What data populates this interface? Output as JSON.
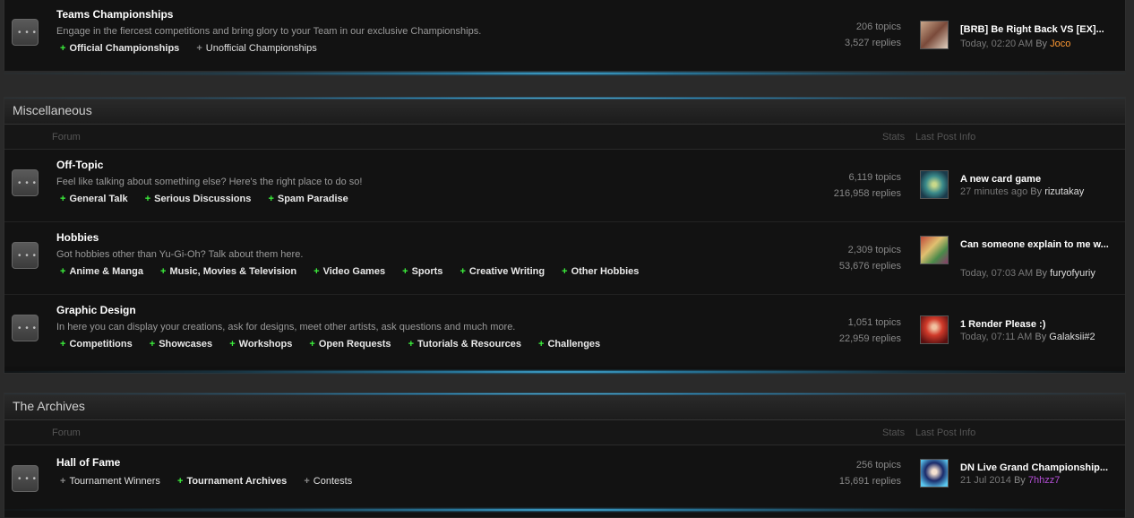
{
  "colors": {
    "accent_glow": "#5fd3ff",
    "plus_green": "#3cf13c",
    "user_orange": "#ff9933",
    "user_purple": "#b44fd6"
  },
  "top_forum": {
    "title": "Teams Championships",
    "desc": "Engage in the fiercest competitions and bring glory to your Team in our exclusive Championships.",
    "subforums": [
      {
        "label": "Official Championships",
        "bold": true
      },
      {
        "label": "Unofficial Championships",
        "bold": false
      }
    ],
    "topics": "206 topics",
    "replies": "3,527 replies",
    "last_title": "[BRB] Be Right Back VS [EX]...",
    "last_time": "Today, 02:20 AM",
    "last_by": "By",
    "last_user": "Joco"
  },
  "misc": {
    "title": "Miscellaneous",
    "col_forum": "Forum",
    "col_stats": "Stats",
    "col_last": "Last Post Info",
    "forums": [
      {
        "title": "Off-Topic",
        "desc": "Feel like talking about something else? Here's the right place to do so!",
        "subforums": [
          "General Talk",
          "Serious Discussions",
          "Spam Paradise"
        ],
        "topics": "6,119 topics",
        "replies": "216,958 replies",
        "last_title": "A new card game",
        "last_time": "27 minutes ago",
        "last_by": "By",
        "last_user": "rizutakay"
      },
      {
        "title": "Hobbies",
        "desc": "Got hobbies other than Yu-Gi-Oh? Talk about them here.",
        "subforums": [
          "Anime & Manga",
          "Music, Movies & Television",
          "Video Games",
          "Sports",
          "Creative Writing",
          "Other Hobbies"
        ],
        "topics": "2,309 topics",
        "replies": "53,676 replies",
        "last_title": "Can someone explain to me w...",
        "last_time": "Today, 07:03 AM",
        "last_by": "By",
        "last_user": "furyofyuriy"
      },
      {
        "title": "Graphic Design",
        "desc": "In here you can display your creations, ask for designs, meet other artists, ask questions and much more.",
        "subforums": [
          "Competitions",
          "Showcases",
          "Workshops",
          "Open Requests",
          "Tutorials & Resources",
          "Challenges"
        ],
        "topics": "1,051 topics",
        "replies": "22,959 replies",
        "last_title": "1 Render Please :)",
        "last_time": "Today, 07:11 AM",
        "last_by": "By",
        "last_user": "Galaksii#2"
      }
    ]
  },
  "archives": {
    "title": "The Archives",
    "col_forum": "Forum",
    "col_stats": "Stats",
    "col_last": "Last Post Info",
    "forum": {
      "title": "Hall of Fame",
      "subforums": [
        {
          "label": "Tournament Winners",
          "bold": false
        },
        {
          "label": "Tournament Archives",
          "bold": true
        },
        {
          "label": "Contests",
          "bold": false
        }
      ],
      "topics": "256 topics",
      "replies": "15,691 replies",
      "last_title": "DN Live Grand Championship...",
      "last_time": "21 Jul 2014",
      "last_by": "By",
      "last_user": "7hhzz7"
    }
  }
}
